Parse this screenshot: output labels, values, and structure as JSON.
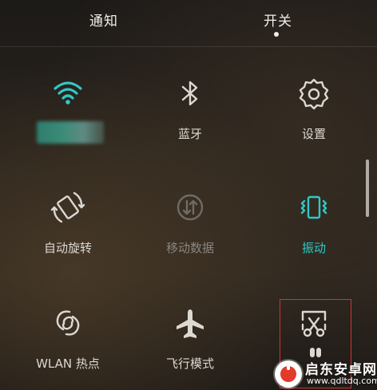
{
  "tabs": {
    "notify": "通知",
    "switch": "开关",
    "active": "switch"
  },
  "toggles": [
    {
      "id": "wifi",
      "icon": "wifi-icon",
      "label": "",
      "state": "on"
    },
    {
      "id": "bluetooth",
      "icon": "bluetooth-icon",
      "label": "蓝牙",
      "state": "off"
    },
    {
      "id": "settings",
      "icon": "gear-icon",
      "label": "设置",
      "state": "off"
    },
    {
      "id": "auto-rotate",
      "icon": "rotate-icon",
      "label": "自动旋转",
      "state": "off"
    },
    {
      "id": "mobile-data",
      "icon": "mobile-data-icon",
      "label": "移动数据",
      "state": "disabled"
    },
    {
      "id": "vibrate",
      "icon": "vibrate-icon",
      "label": "振动",
      "state": "on"
    },
    {
      "id": "wlan-hotspot",
      "icon": "hotspot-icon",
      "label": "WLAN 热点",
      "state": "off"
    },
    {
      "id": "airplane",
      "icon": "airplane-icon",
      "label": "飞行模式",
      "state": "off"
    },
    {
      "id": "screenshot",
      "icon": "screenshot-scissors-icon",
      "label": "",
      "state": "off"
    }
  ],
  "colors": {
    "accent": "#32c7c6",
    "icon": "#dcd8d2",
    "disabled": "#8a8681",
    "highlight": "#d23232"
  },
  "watermark": {
    "title": "启东安卓网",
    "url": "www.qdltdq.com"
  }
}
